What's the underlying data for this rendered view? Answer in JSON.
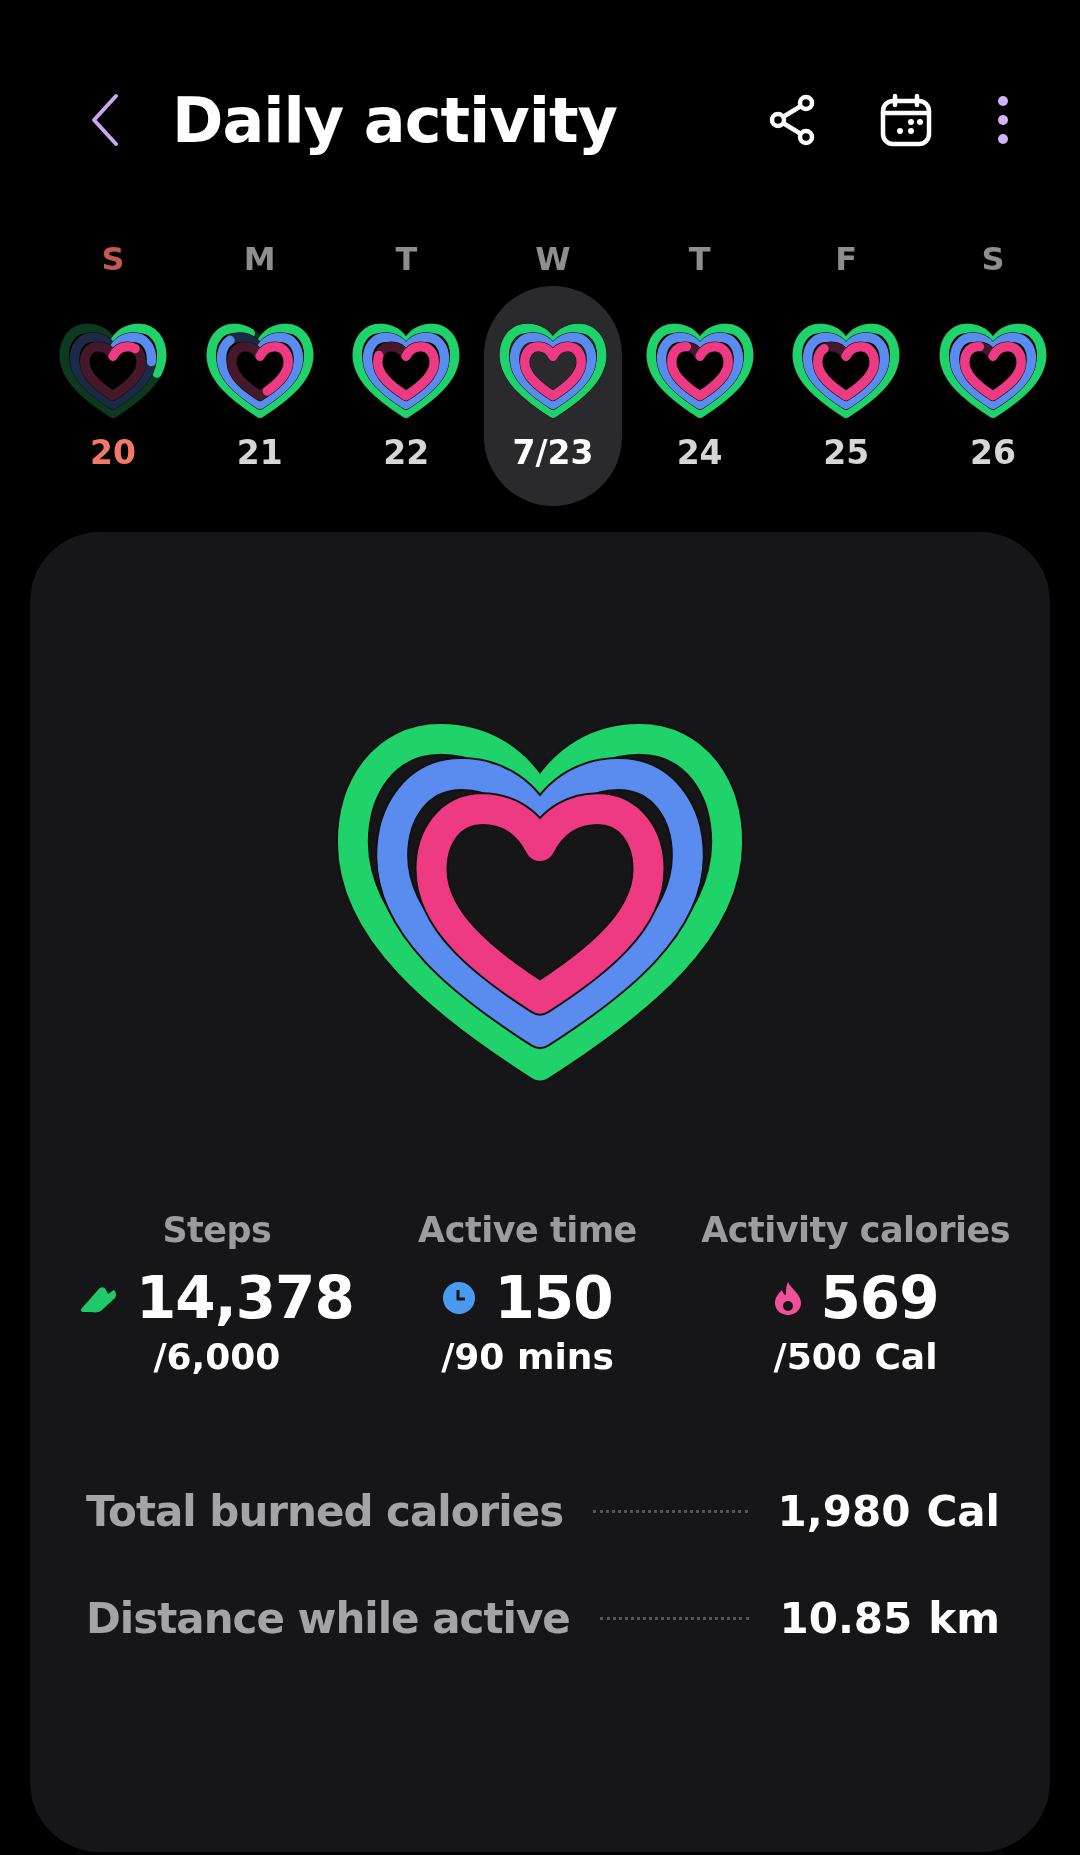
{
  "header": {
    "title": "Daily activity"
  },
  "days": [
    {
      "weekday": "S",
      "date": "20",
      "sunday": true,
      "selected": false
    },
    {
      "weekday": "M",
      "date": "21",
      "sunday": false,
      "selected": false
    },
    {
      "weekday": "T",
      "date": "22",
      "sunday": false,
      "selected": false
    },
    {
      "weekday": "W",
      "date": "7/23",
      "sunday": false,
      "selected": true
    },
    {
      "weekday": "T",
      "date": "24",
      "sunday": false,
      "selected": false
    },
    {
      "weekday": "F",
      "date": "25",
      "sunday": false,
      "selected": false
    },
    {
      "weekday": "S",
      "date": "26",
      "sunday": false,
      "selected": false
    }
  ],
  "summary": {
    "stats": [
      {
        "kind": "steps",
        "label": "Steps",
        "value": "14,378",
        "goal": "/6,000"
      },
      {
        "kind": "time",
        "label": "Active time",
        "value": "150",
        "goal": "/90 mins"
      },
      {
        "kind": "calories",
        "label": "Activity calories",
        "value": "569",
        "goal": "/500 Cal"
      }
    ],
    "totals": [
      {
        "label": "Total burned calories",
        "value": "1,980",
        "unit": "Cal"
      },
      {
        "label": "Distance while active",
        "value": "10.85",
        "unit": "km"
      }
    ]
  }
}
